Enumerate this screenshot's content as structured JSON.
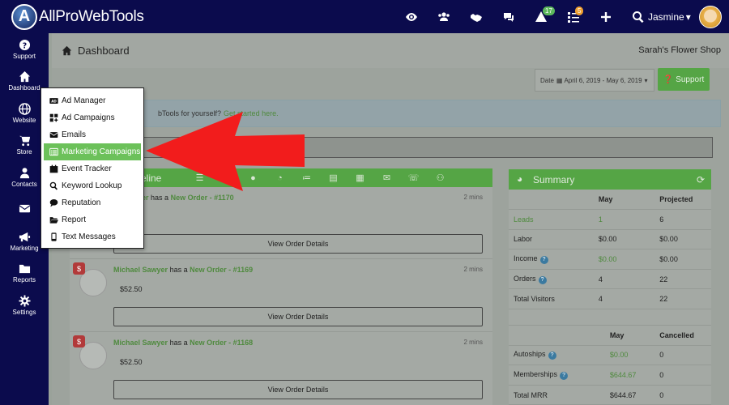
{
  "header": {
    "logo_letter": "A",
    "app_name": "AllProWebTools",
    "user_name": "Jasmine",
    "user_caret": "▾",
    "icons": [
      "eye-icon",
      "users-icon",
      "handshake-icon",
      "chat-icon",
      "alert-icon",
      "tasks-icon",
      "plus-icon",
      "search-icon"
    ],
    "alert_badge": "17",
    "tasks_badge": "5"
  },
  "sidebar": {
    "items": [
      {
        "label": "Support",
        "icon": "question-icon"
      },
      {
        "label": "Dashboard",
        "icon": "home-icon"
      },
      {
        "label": "Website",
        "icon": "globe-icon"
      },
      {
        "label": "Store",
        "icon": "cart-icon"
      },
      {
        "label": "Contacts",
        "icon": "person-icon"
      },
      {
        "label": "",
        "icon": "envelope-icon"
      },
      {
        "label": "Marketing",
        "icon": "megaphone-icon"
      },
      {
        "label": "Reports",
        "icon": "folder-icon"
      },
      {
        "label": "Settings",
        "icon": "gear-icon"
      }
    ]
  },
  "page": {
    "title": "Dashboard",
    "shop_name": "Sarah's Flower Shop",
    "date_label": "Date",
    "date_range": "April 6, 2019 - May 6, 2019",
    "support_button": "Support",
    "banner_text": "bTools for yourself?",
    "banner_link": "Get started here."
  },
  "timeline": {
    "title": "eline",
    "icons": [
      "list-icon",
      "dollar-icon",
      "chat-icon",
      "clock-icon",
      "checklist-icon",
      "newspaper-icon",
      "list-alt-icon",
      "envelope-icon",
      "phone-icon",
      "users-icon"
    ],
    "icon_glyphs": [
      "☰",
      "$",
      "",
      "",
      "",
      "",
      "",
      "",
      "",
      ""
    ],
    "orders": [
      {
        "name": "Sawyer",
        "has": "has a",
        "order": "New Order - #1170",
        "time": "2 mins",
        "amount": "",
        "button": "View Order Details"
      },
      {
        "name": "Michael Sawyer",
        "has": "has a",
        "order": "New Order - #1169",
        "time": "2 mins",
        "amount": "$52.50",
        "button": "View Order Details"
      },
      {
        "name": "Michael Sawyer",
        "has": "has a",
        "order": "New Order - #1168",
        "time": "2 mins",
        "amount": "$52.50",
        "button": "View Order Details"
      }
    ]
  },
  "summary": {
    "title": "Summary",
    "headers": [
      "",
      "May",
      "Projected"
    ],
    "rows": [
      {
        "label": "Leads",
        "may": "1",
        "projected": "6"
      },
      {
        "label": "Labor",
        "may": "$0.00",
        "projected": "$0.00"
      },
      {
        "label": "Income",
        "may": "$0.00",
        "projected": "$0.00"
      },
      {
        "label": "Orders",
        "may": "4",
        "projected": "22"
      },
      {
        "label": "Total Visitors",
        "may": "4",
        "projected": "22"
      }
    ],
    "headers2": [
      "",
      "May",
      "Cancelled"
    ],
    "rows2": [
      {
        "label": "Autoships",
        "may": "$0.00",
        "cancelled": "0"
      },
      {
        "label": "Memberships",
        "may": "$644.67",
        "cancelled": "0"
      },
      {
        "label": "Total MRR",
        "may": "$644.67",
        "cancelled": "0"
      }
    ]
  },
  "marketing_menu": {
    "items": [
      {
        "label": "Ad Manager",
        "icon": "ad-icon"
      },
      {
        "label": "Ad Campaigns",
        "icon": "grid-icon"
      },
      {
        "label": "Emails",
        "icon": "envelope-icon"
      },
      {
        "label": "Marketing Campaigns",
        "icon": "list-alt-icon"
      },
      {
        "label": "Event Tracker",
        "icon": "calendar-icon"
      },
      {
        "label": "Keyword Lookup",
        "icon": "search-icon"
      },
      {
        "label": "Reputation",
        "icon": "chat-icon"
      },
      {
        "label": "Report",
        "icon": "folder-open-icon"
      },
      {
        "label": "Text Messages",
        "icon": "mobile-icon"
      }
    ],
    "active_index": 3
  },
  "colors": {
    "navy": "#0b0b4d",
    "green": "#6cc15a",
    "arrow_red": "#f21c1c"
  }
}
